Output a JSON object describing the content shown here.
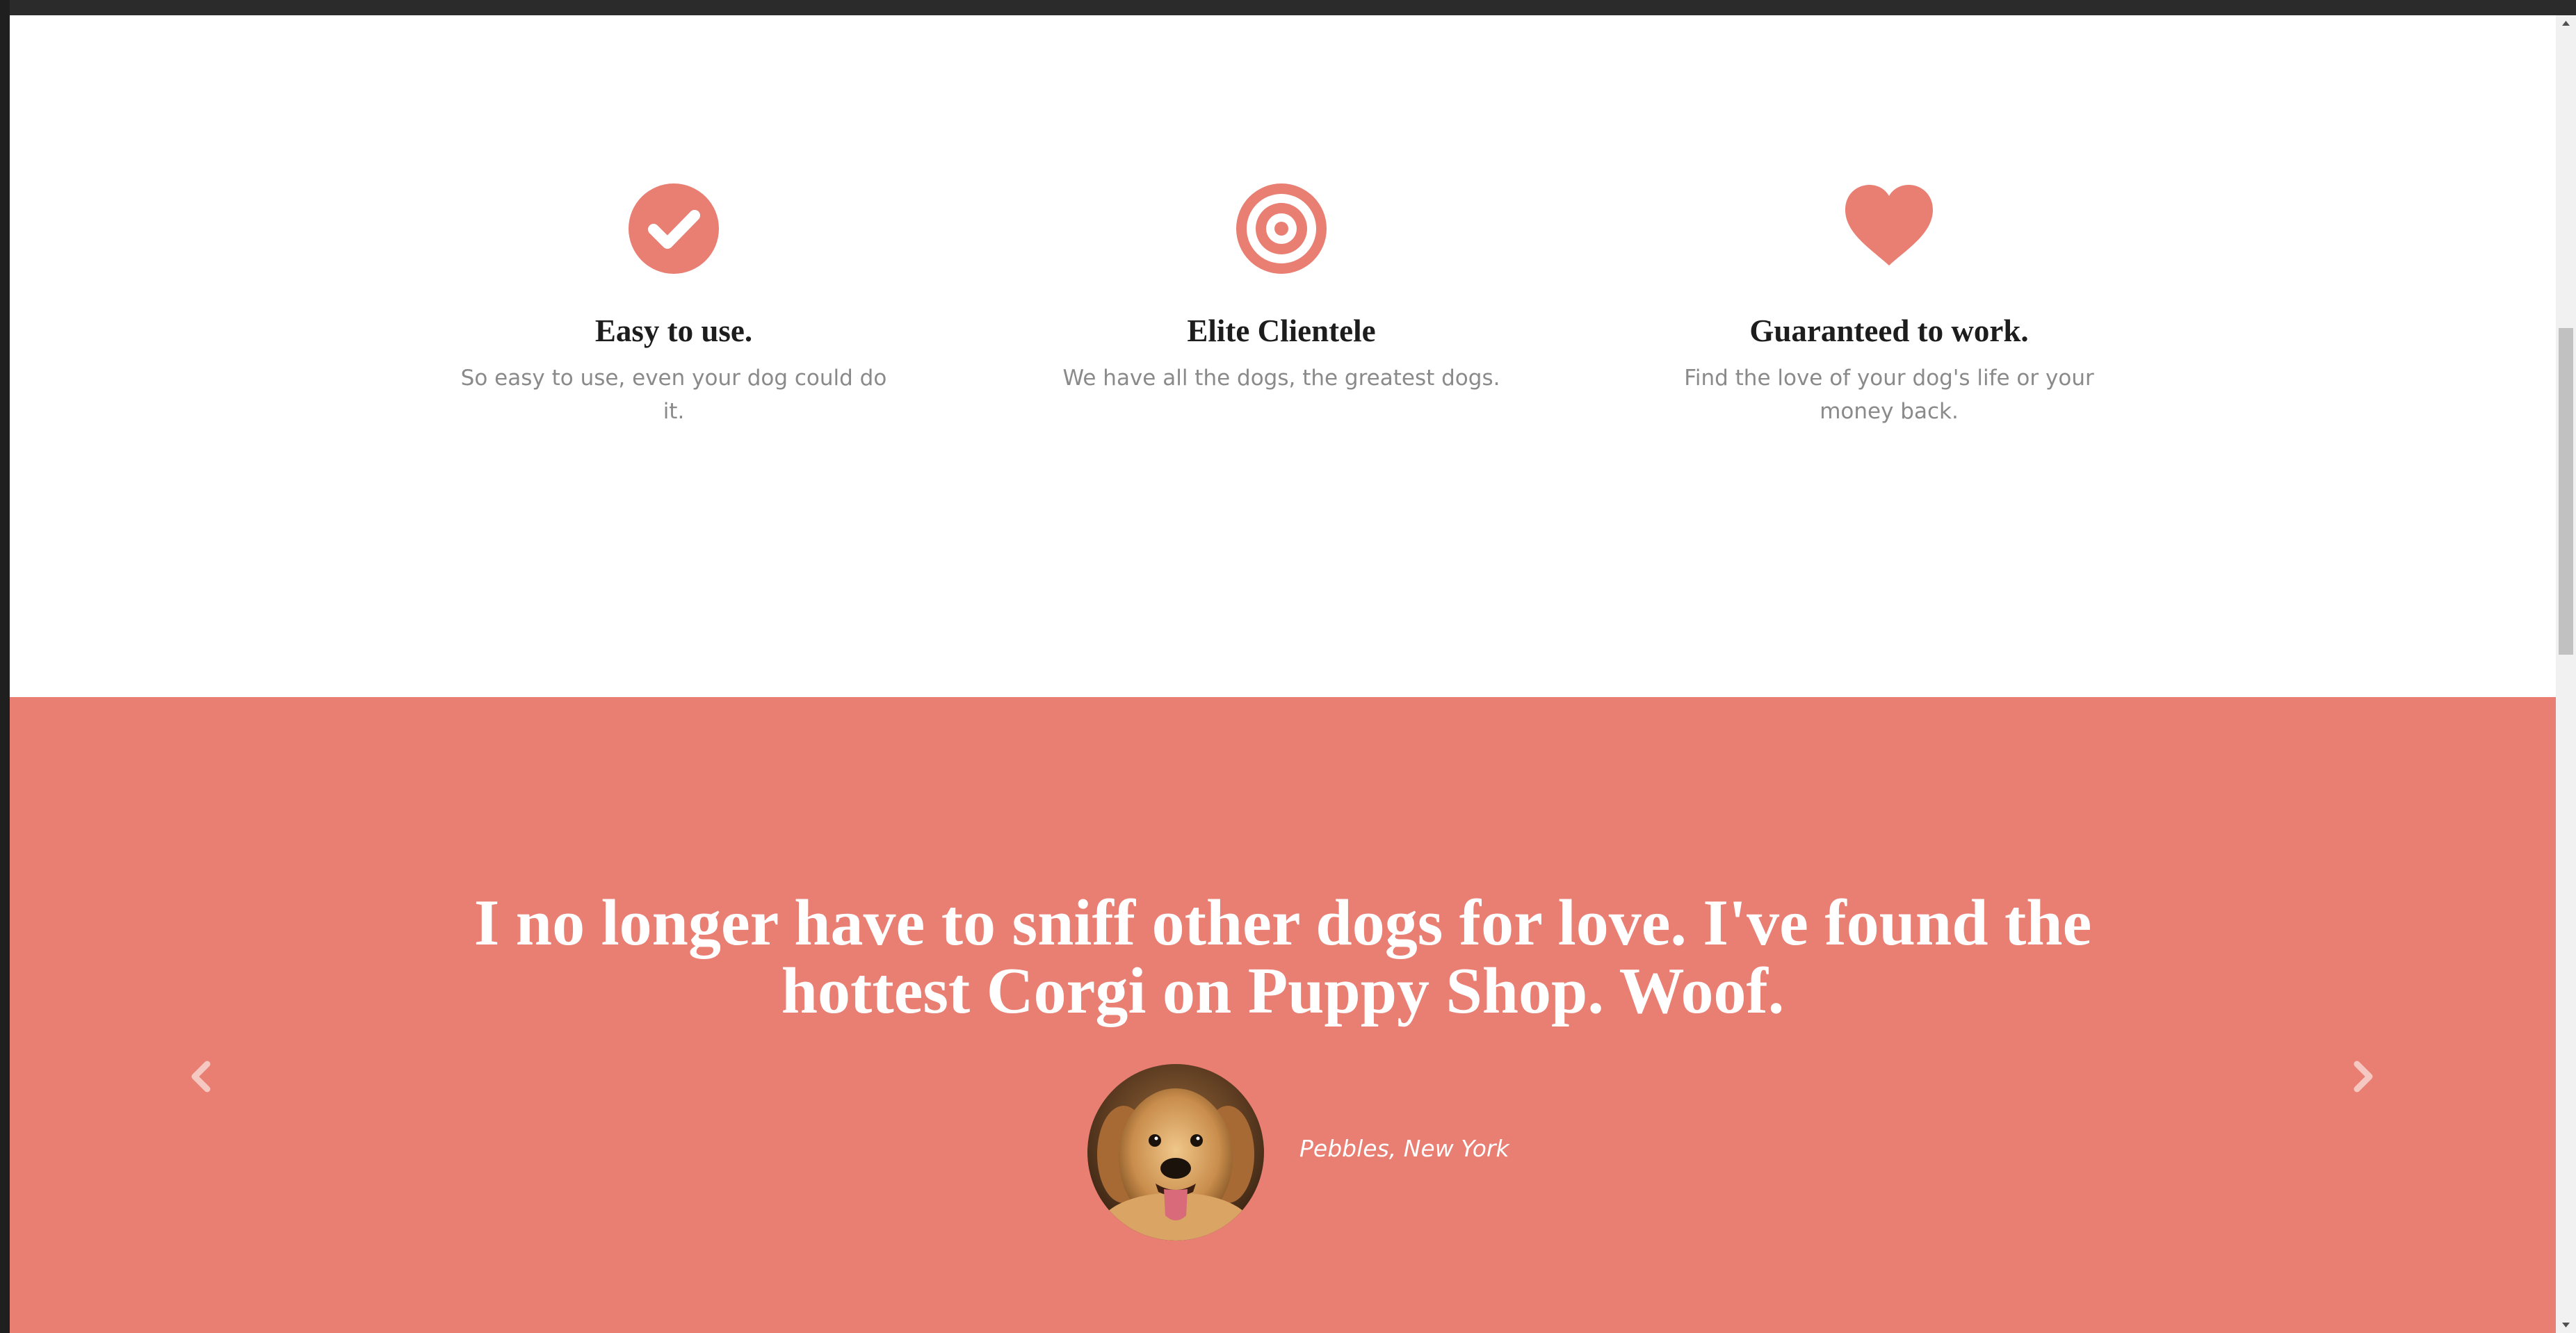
{
  "features": [
    {
      "icon": "check-circle-icon",
      "title": "Easy to use.",
      "description": "So easy to use, even your dog could do it."
    },
    {
      "icon": "target-icon",
      "title": "Elite Clientele",
      "description": "We have all the dogs, the greatest dogs."
    },
    {
      "icon": "heart-icon",
      "title": "Guaranteed to work.",
      "description": "Find the love of your dog's life or your money back."
    }
  ],
  "testimonial": {
    "quote": "I no longer have to sniff other dogs for love. I've found the hottest Corgi on Puppy Shop. Woof.",
    "author": "Pebbles, New York",
    "avatar": "dog-avatar",
    "prev_icon": "chevron-left-icon",
    "next_icon": "chevron-right-icon"
  },
  "colors": {
    "accent": "#e97e72",
    "title": "#1d1d1d",
    "muted_text": "#8a8a8a",
    "white": "#ffffff"
  }
}
